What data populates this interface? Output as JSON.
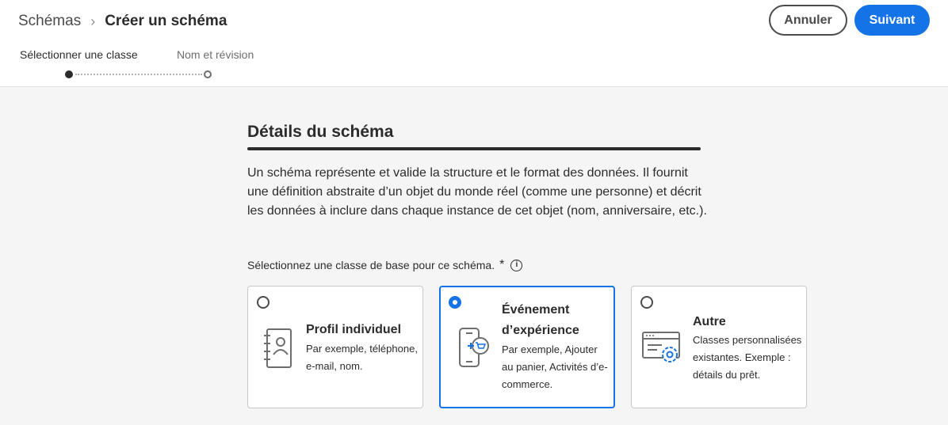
{
  "header": {
    "breadcrumb_parent": "Schémas",
    "breadcrumb_separator": "›",
    "breadcrumb_current": "Créer un schéma",
    "cancel_label": "Annuler",
    "next_label": "Suivant"
  },
  "steps": [
    {
      "label": "Sélectionner une classe",
      "state": "current"
    },
    {
      "label": "Nom et révision",
      "state": "pending"
    }
  ],
  "section": {
    "title": "Détails du schéma",
    "description": "Un schéma représente et valide la structure et le format des données. Il fournit une définition abstraite d’un objet du monde réel (comme une personne) et décrit les données à inclure dans chaque instance de cet  objet (nom, anniversaire, etc.).",
    "select_label": "Sélectionnez une classe de base pour ce schéma.",
    "required_mark": "*",
    "info_icon": "info-icon"
  },
  "classes": [
    {
      "title": "Profil individuel",
      "description": "Par exemple, téléphone, e-mail, nom.",
      "icon": "contact-book-icon",
      "selected": false
    },
    {
      "title": "Événement d’expérience",
      "description": "Par exemple, Ajouter au panier, Activités d’e- commerce.",
      "icon": "mobile-cart-icon",
      "selected": true
    },
    {
      "title": "Autre",
      "description": "Classes personnalisées existantes. Exemple : détails du prêt.",
      "icon": "window-gear-icon",
      "selected": false
    }
  ],
  "colors": {
    "accent": "#1473e6",
    "text": "#2c2c2c",
    "background": "#f5f5f5"
  }
}
